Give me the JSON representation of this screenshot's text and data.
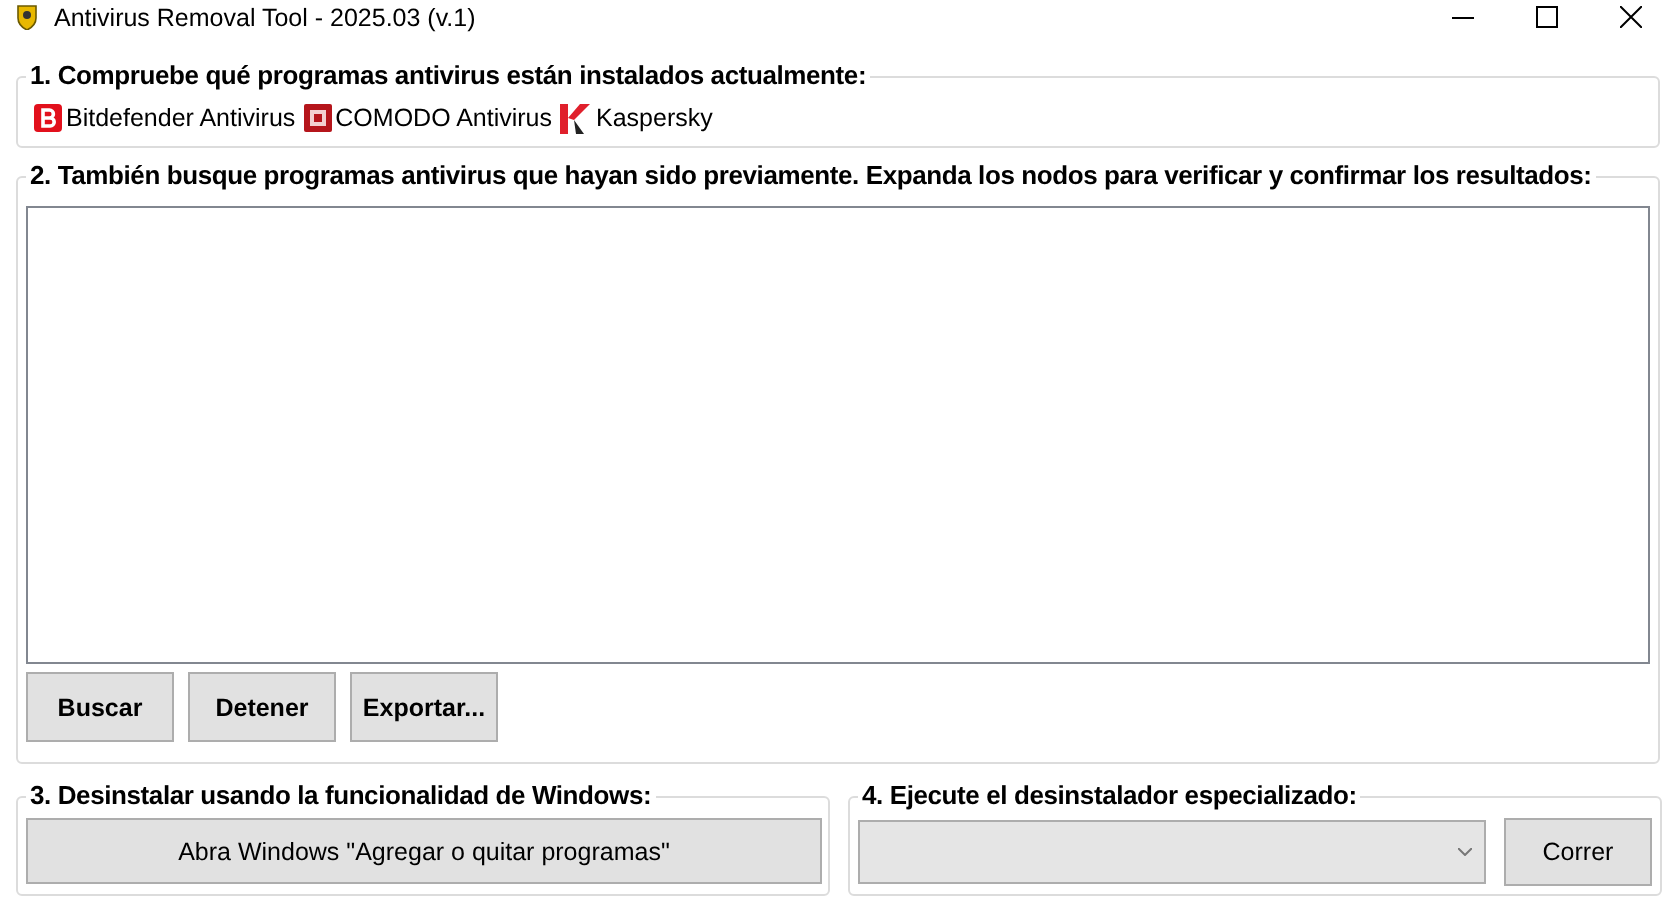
{
  "window": {
    "title": "Antivirus Removal Tool - 2025.03 (v.1)"
  },
  "installed": {
    "title": "1. Compruebe qué programas antivirus están instalados actualmente:",
    "products": [
      {
        "name": "Bitdefender Antivirus",
        "kind": "badge"
      },
      {
        "name": "COMODO Antivirus",
        "kind": "tile"
      },
      {
        "name": "Kaspersky",
        "kind": "slash"
      }
    ]
  },
  "previous": {
    "title": "2. También busque programas antivirus que hayan sido previamente. Expanda los nodos para verificar y confirmar los resultados:",
    "buttons": [
      "Buscar",
      "Detener",
      "Exportar..."
    ]
  },
  "windows_uninstall": {
    "title": "3. Desinstalar usando la funcionalidad de Windows:",
    "button": "Abra Windows \"Agregar o quitar programas\""
  },
  "special": {
    "title": "4. Ejecute el desinstalador especializado:",
    "button": "Correr"
  }
}
